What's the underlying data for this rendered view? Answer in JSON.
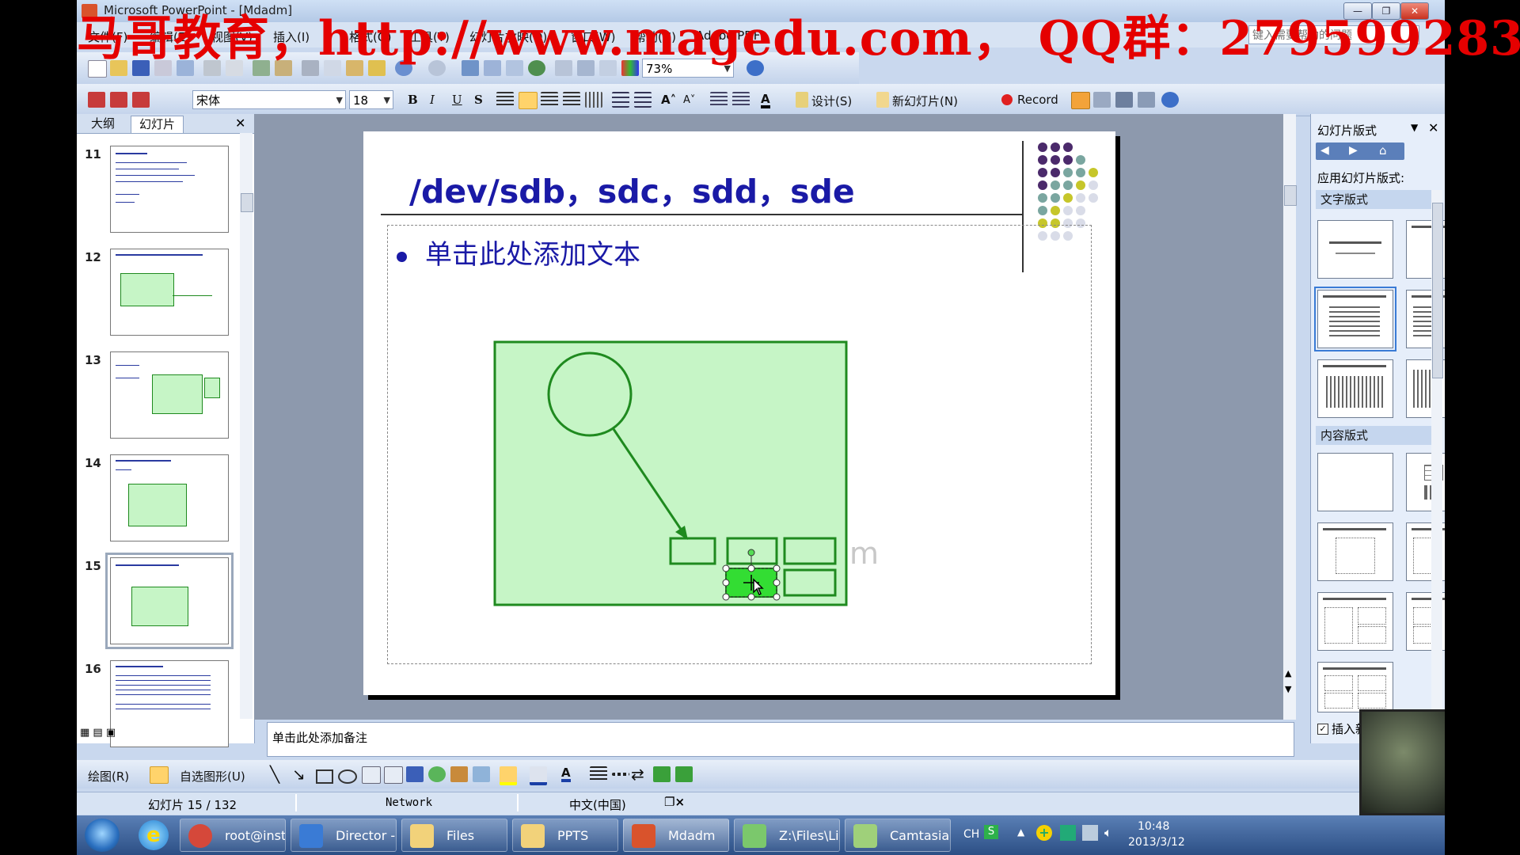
{
  "watermark": "马哥教育，http://www.magedu.com， QQ群：279599283",
  "window": {
    "title": "Microsoft PowerPoint - [Mdadm]",
    "help_box": "键入需要帮助的问题"
  },
  "menu": [
    "文件(F)",
    "编辑(E)",
    "视图(V)",
    "插入(I)",
    "格式(O)",
    "工具(T)",
    "幻灯片放映(D)",
    "窗口(W)",
    "帮助(H)",
    "Adobe PDF"
  ],
  "toolbar1": {
    "zoom": "73%"
  },
  "toolbar2": {
    "font": "宋体",
    "size": "18",
    "design_label": "设计(S)",
    "new_slide_label": "新幻灯片(N)",
    "record_label": "Record"
  },
  "leftpane": {
    "tabs": [
      "大纲",
      "幻灯片"
    ],
    "slides": [
      {
        "num": "11"
      },
      {
        "num": "12"
      },
      {
        "num": "13"
      },
      {
        "num": "14"
      },
      {
        "num": "15"
      },
      {
        "num": "16"
      }
    ]
  },
  "slide": {
    "title": "/dev/sdb，sdc，sdd，sde",
    "bullet": "单击此处添加文本",
    "ghost_text": "m"
  },
  "taskpane": {
    "title": "幻灯片版式",
    "apply_label": "应用幻灯片版式:",
    "section_text": "文字版式",
    "section_content": "内容版式",
    "insert_checkbox": "插入新幻灯片时放"
  },
  "notes": {
    "placeholder": "单击此处添加备注"
  },
  "drawbar": {
    "draw_label": "绘图(R)",
    "autoshape_label": "自选图形(U)"
  },
  "status": {
    "slide_counter": "幻灯片 15 / 132",
    "design": "Network",
    "language": "中文(中国)"
  },
  "taskbar": {
    "tasks": [
      "root@inst...",
      "Director - ...",
      "Files",
      "PPTS",
      "Mdadm",
      "Z:\\Files\\Lin...",
      "Camtasia ..."
    ],
    "clock_time": "10:48",
    "clock_date": "2013/3/12",
    "lang_indicator": "CH"
  },
  "colors": {
    "shape_fill": "#c6f5c6",
    "shape_stroke": "#1f8a1f",
    "selected_shape": "#33dd33",
    "title_text": "#1a1aa6",
    "watermark": "#e50000"
  }
}
